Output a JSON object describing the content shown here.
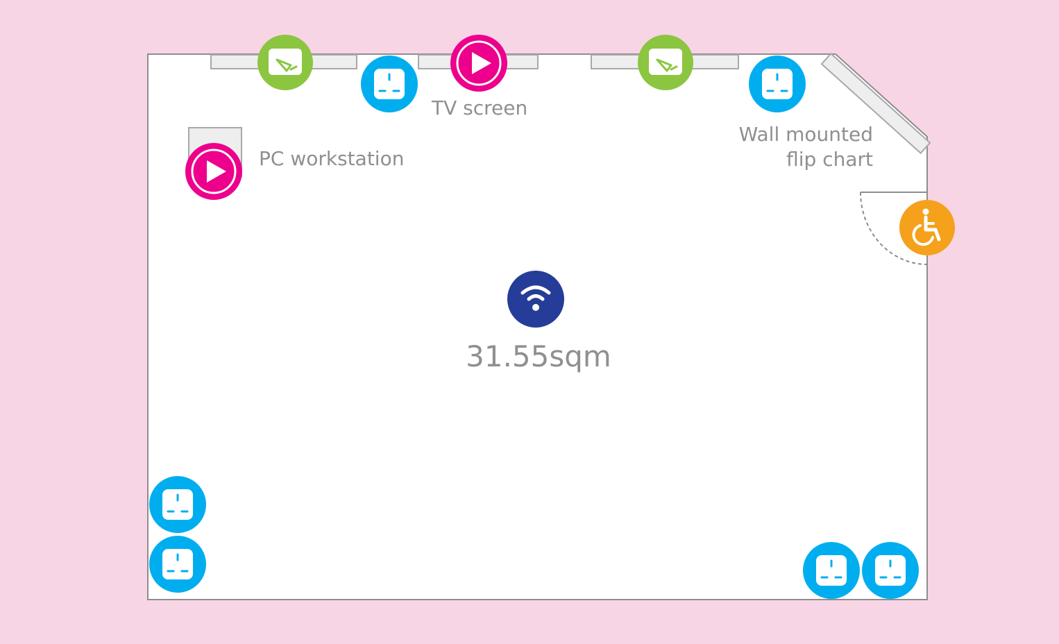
{
  "room": {
    "area": "31.55sqm"
  },
  "labels": {
    "pc_workstation": "PC workstation",
    "tv_screen": "TV screen",
    "flip_chart_line1": "Wall mounted",
    "flip_chart_line2": "flip chart"
  },
  "icons": {
    "whiteboard": "whiteboard-icon",
    "power_socket": "power-socket-icon",
    "av_play": "av-play-icon",
    "accessible_entrance": "wheelchair-icon",
    "wifi": "wifi-icon"
  },
  "colors": {
    "background": "#f8d5e5",
    "floor": "#ffffff",
    "wall": "#8d8d8d",
    "fixture_fill": "#eeeeee",
    "fixture_stroke": "#a8a8a8",
    "whiteboard": "#8cc540",
    "power_socket": "#00aeef",
    "av_play": "#ec008c",
    "wheelchair": "#f5a11c",
    "wifi": "#253d98",
    "label_text": "#8f8f8f"
  }
}
